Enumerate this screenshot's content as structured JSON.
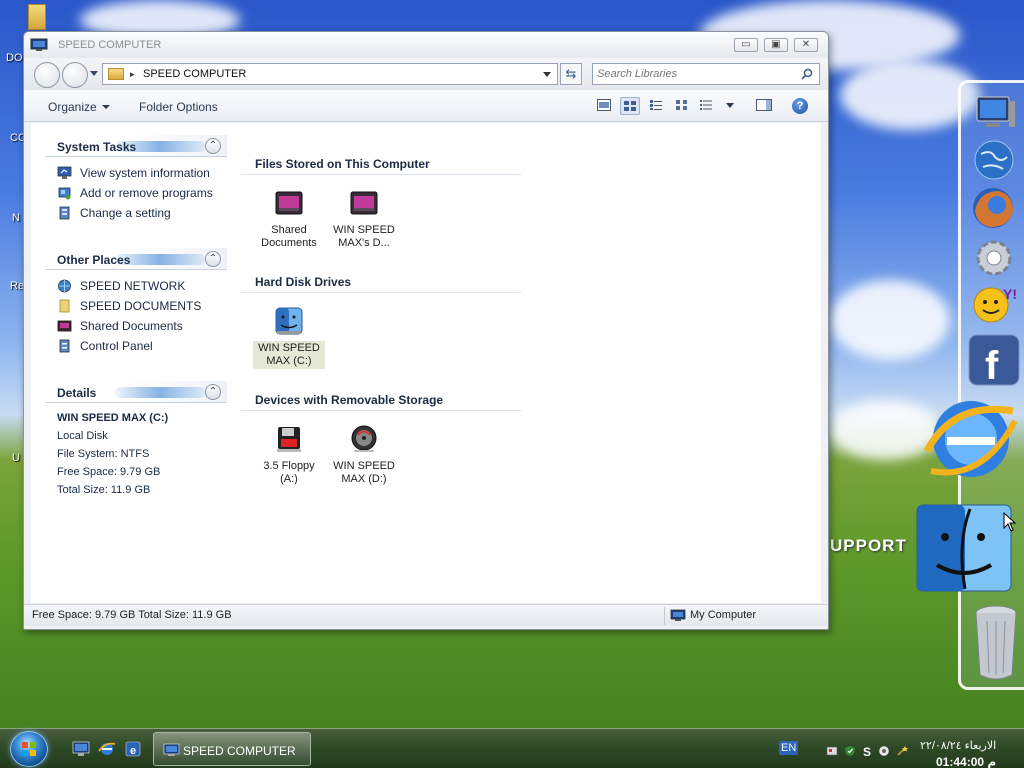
{
  "desktop": {
    "labels": [
      "DO",
      "CO",
      "N",
      "Re",
      "U"
    ],
    "support_text": "UPPORT"
  },
  "window": {
    "title": "SPEED COMPUTER",
    "buttons": {
      "minimize": "▭",
      "maximize": "▣",
      "close": "✕"
    },
    "address": {
      "path": "SPEED COMPUTER",
      "separator": "▸"
    },
    "search": {
      "placeholder": "Search Libraries"
    },
    "toolbar": {
      "organize": "Organize",
      "folder_options": "Folder Options",
      "help": "?"
    },
    "sidebar": {
      "system_tasks": {
        "title": "System Tasks",
        "items": [
          "View system information",
          "Add or remove programs",
          "Change a setting"
        ]
      },
      "other_places": {
        "title": "Other Places",
        "items": [
          "SPEED NETWORK",
          "SPEED DOCUMENTS",
          "Shared Documents",
          "Control Panel"
        ]
      },
      "details": {
        "title": "Details",
        "name": "WIN SPEED MAX (C:)",
        "type": "Local Disk",
        "file_system": "File System: NTFS",
        "free_space": "Free Space: 9.79 GB",
        "total_size": "Total Size: 11.9 GB"
      }
    },
    "groups": {
      "files": {
        "title": "Files Stored on This Computer",
        "items": [
          {
            "line1": "Shared",
            "line2": "Documents"
          },
          {
            "line1": "WIN SPEED",
            "line2": "MAX's D..."
          }
        ]
      },
      "hdd": {
        "title": "Hard Disk Drives",
        "items": [
          {
            "line1": "WIN SPEED",
            "line2": "MAX (C:)"
          }
        ]
      },
      "removable": {
        "title": "Devices with Removable Storage",
        "items": [
          {
            "line1": "3.5 Floppy",
            "line2": "(A:)"
          },
          {
            "line1": "WIN SPEED",
            "line2": "MAX (D:)"
          }
        ]
      }
    },
    "status": {
      "left": "Free Space: 9.79 GB Total Size: 11.9 GB",
      "right": "My Computer"
    }
  },
  "taskbar": {
    "task_button": "SPEED COMPUTER",
    "language": "EN",
    "date": "الاربعاء ٢٢/٠٨/٢٤",
    "time": "01:44:00 م"
  },
  "colors": {
    "accent": "#1c4fa8",
    "taskbar": "#2f4a26",
    "window_bg": "#eef0f3"
  }
}
